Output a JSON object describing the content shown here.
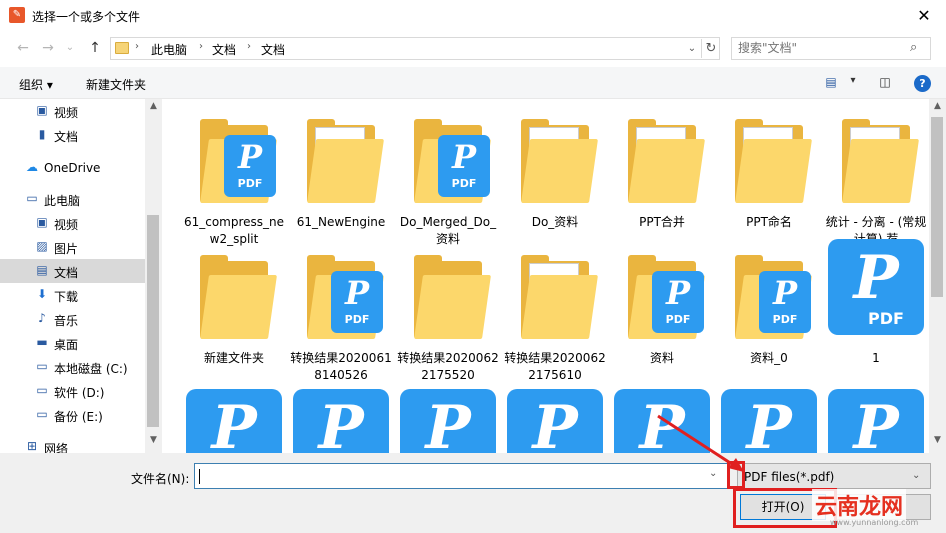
{
  "window": {
    "title": "选择一个或多个文件",
    "close_glyph": "✕",
    "app_icon_text": "✎"
  },
  "nav": {
    "back": "←",
    "forward": "→",
    "recent": "⌄",
    "up": "↑"
  },
  "address": {
    "crumbs": [
      "此电脑",
      "文档",
      "文档"
    ],
    "separator": "›",
    "dropdown": "⌄",
    "refresh": "↻"
  },
  "search": {
    "placeholder": "搜索\"文档\"",
    "icon": "⌕"
  },
  "toolbar": {
    "organize": "组织 ▾",
    "new_folder": "新建文件夹",
    "view_icon": "▤",
    "view_dd": "▾",
    "pane_icon": "◫",
    "help": "?"
  },
  "sidebar": [
    {
      "label": "视频",
      "icon": "▣",
      "name": "sidebar-item-videos-quick",
      "indent": 1
    },
    {
      "label": "文档",
      "icon": "▮",
      "name": "sidebar-item-docs-quick",
      "indent": 1
    },
    {
      "label": "OneDrive",
      "icon": "☁",
      "name": "sidebar-item-onedrive",
      "indent": 0
    },
    {
      "label": "此电脑",
      "icon": "▭",
      "name": "sidebar-item-this-pc",
      "indent": 0
    },
    {
      "label": "视频",
      "icon": "▣",
      "name": "sidebar-item-videos",
      "indent": 1
    },
    {
      "label": "图片",
      "icon": "▨",
      "name": "sidebar-item-pictures",
      "indent": 1
    },
    {
      "label": "文档",
      "icon": "▤",
      "name": "sidebar-item-documents",
      "indent": 1,
      "selected": true
    },
    {
      "label": "下载",
      "icon": "⬇",
      "name": "sidebar-item-downloads",
      "indent": 1
    },
    {
      "label": "音乐",
      "icon": "♪",
      "name": "sidebar-item-music",
      "indent": 1
    },
    {
      "label": "桌面",
      "icon": "▬",
      "name": "sidebar-item-desktop",
      "indent": 1
    },
    {
      "label": "本地磁盘 (C:)",
      "icon": "▭",
      "name": "sidebar-item-drive-c",
      "indent": 1
    },
    {
      "label": "软件 (D:)",
      "icon": "▭",
      "name": "sidebar-item-drive-d",
      "indent": 1
    },
    {
      "label": "备份 (E:)",
      "icon": "▭",
      "name": "sidebar-item-drive-e",
      "indent": 1
    },
    {
      "label": "网络",
      "icon": "⊞",
      "name": "sidebar-item-network",
      "indent": 0
    }
  ],
  "files": [
    {
      "label": "61_compress_new2_split",
      "kind": "folder-pdf"
    },
    {
      "label": "61_NewEngine",
      "kind": "folder-doc"
    },
    {
      "label": "Do_Merged_Do_资料",
      "kind": "folder-pdf"
    },
    {
      "label": "Do_资料",
      "kind": "folder-doc"
    },
    {
      "label": "PPT合并",
      "kind": "folder-doc"
    },
    {
      "label": "PPT命名",
      "kind": "folder-doc"
    },
    {
      "label": "统计 - 分离 - (常规计算) 荐",
      "kind": "folder-doc"
    },
    {
      "label": "新建文件夹",
      "kind": "folder"
    },
    {
      "label": "转换结果20200618140526",
      "kind": "folder-pdf"
    },
    {
      "label": "转换结果20200622175520",
      "kind": "folder"
    },
    {
      "label": "转换结果20200622175610",
      "kind": "folder-doc"
    },
    {
      "label": "资料",
      "kind": "folder-pdf"
    },
    {
      "label": "资料_0",
      "kind": "folder-pdf"
    },
    {
      "label": "1",
      "kind": "pdf"
    },
    {
      "label": "",
      "kind": "pdf"
    },
    {
      "label": "",
      "kind": "pdf"
    },
    {
      "label": "",
      "kind": "pdf"
    },
    {
      "label": "",
      "kind": "pdf"
    },
    {
      "label": "",
      "kind": "pdf"
    },
    {
      "label": "",
      "kind": "pdf"
    },
    {
      "label": "",
      "kind": "pdf"
    }
  ],
  "pdf_text": "PDF",
  "pdf_logo": "P",
  "bottom": {
    "filename_label": "文件名(N):",
    "filename_value": "",
    "filetype": "PDF files(*.pdf)",
    "open_button": "打开(O)"
  },
  "watermark": {
    "text": "云南龙网",
    "sub": "www.yunnanlong.com"
  },
  "scroll": {
    "up": "▲",
    "down": "▼"
  },
  "colors": {
    "accent": "#0078d7",
    "pdf_blue": "#2d9bf0",
    "folder": "#fcd76b",
    "highlight": "#e02020"
  }
}
